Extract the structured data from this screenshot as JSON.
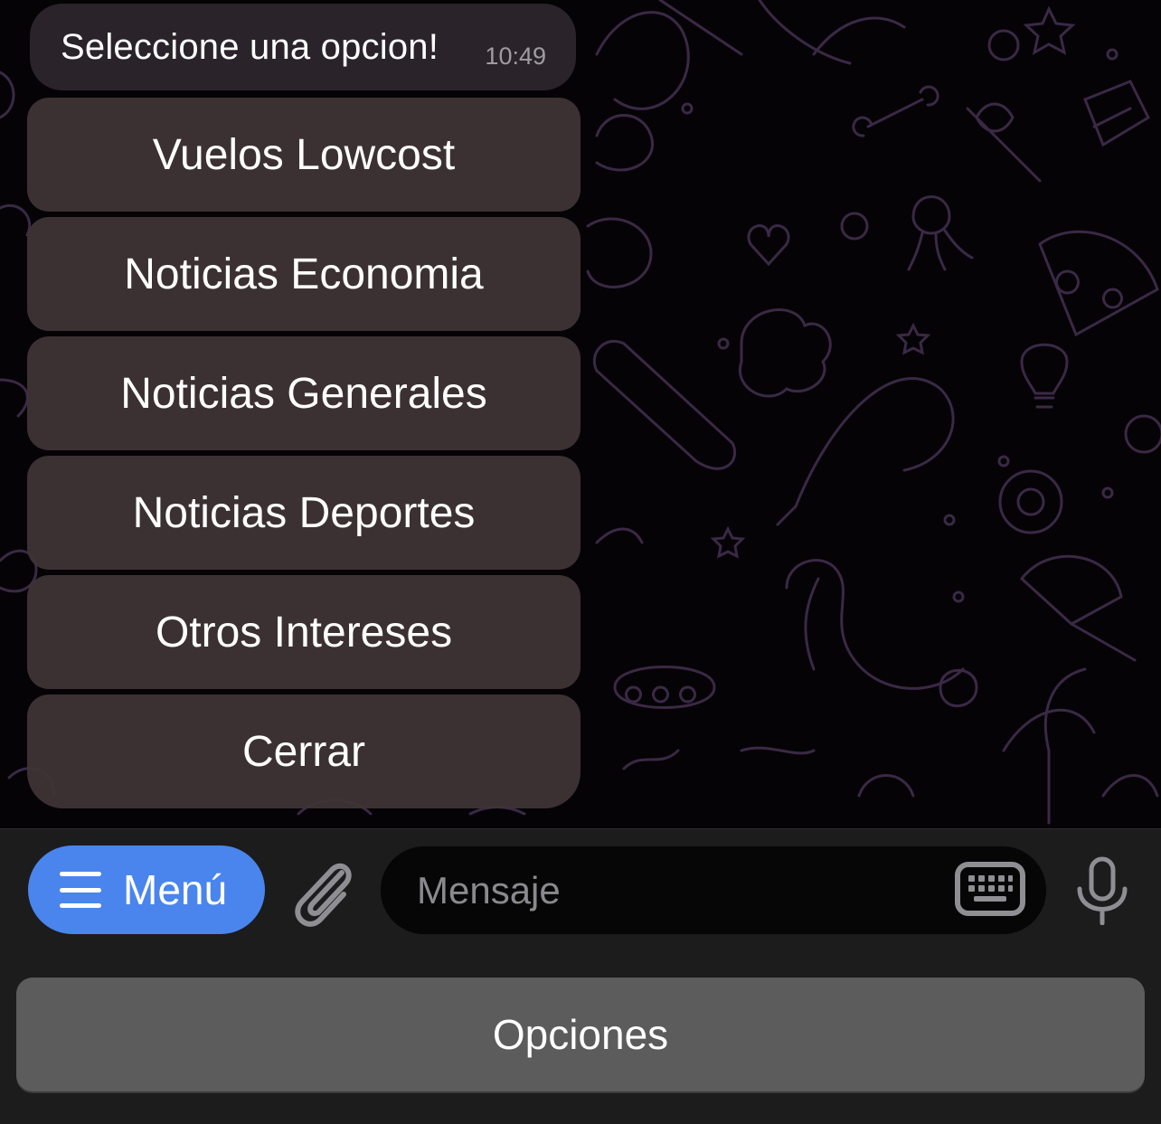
{
  "message": {
    "text": "Seleccione una opcion!",
    "time": "10:49"
  },
  "inline_keyboard": [
    "Vuelos Lowcost",
    "Noticias Economia",
    "Noticias Generales",
    "Noticias Deportes",
    "Otros Intereses",
    "Cerrar"
  ],
  "input_bar": {
    "menu_label": "Menú",
    "placeholder": "Mensaje"
  },
  "reply_keyboard": {
    "button_label": "Opciones"
  },
  "colors": {
    "menu_button": "#4a85ed",
    "doodle_stroke": "#3e2c48"
  }
}
